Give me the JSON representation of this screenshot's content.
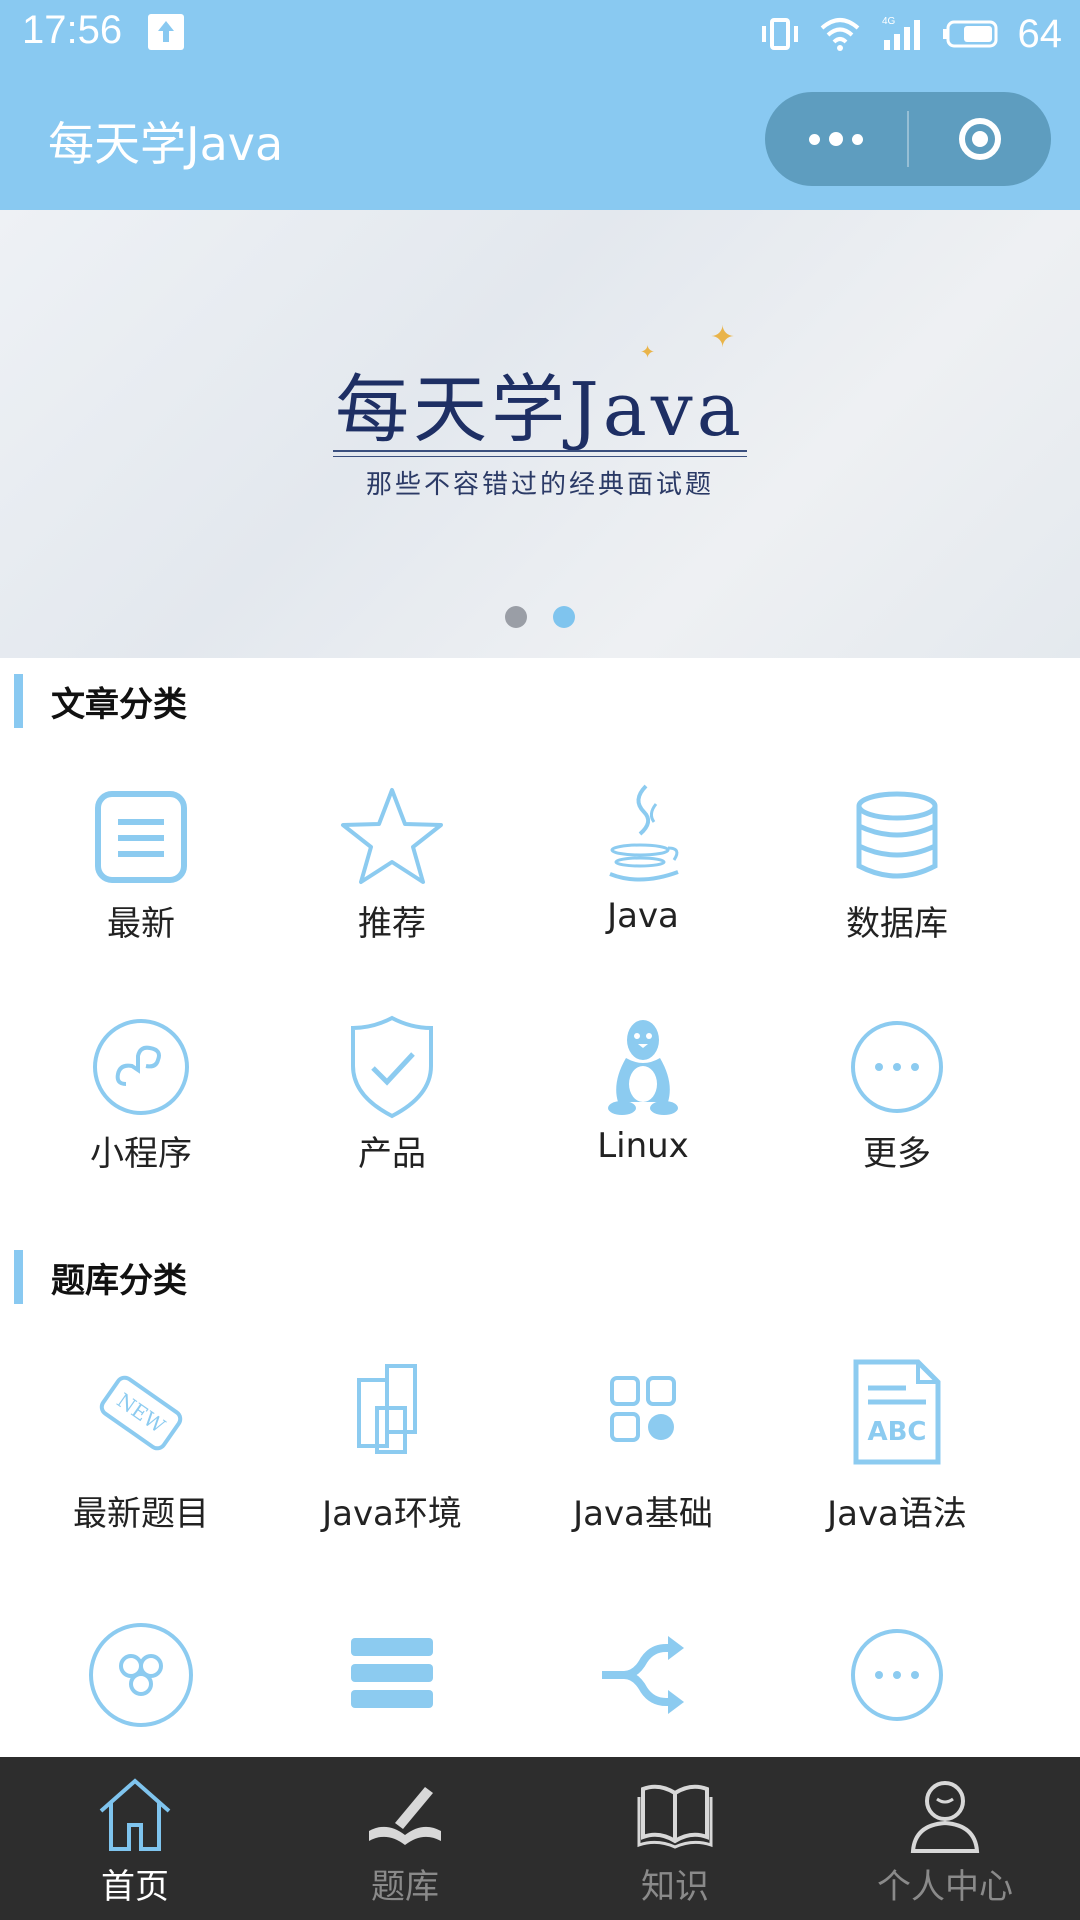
{
  "status_bar": {
    "time": "17:56",
    "battery": "64",
    "network": "4G"
  },
  "navbar": {
    "title": "每天学Java",
    "more_label": "more",
    "close_label": "close"
  },
  "banner": {
    "title": "每天学Java",
    "subtitle": "那些不容错过的经典面试题",
    "slide_count": 2,
    "active_slide": 2
  },
  "article_section": {
    "title": "文章分类",
    "items": [
      {
        "label": "最新",
        "icon": "list-doc-icon"
      },
      {
        "label": "推荐",
        "icon": "star-icon"
      },
      {
        "label": "Java",
        "icon": "java-cup-icon"
      },
      {
        "label": "数据库",
        "icon": "database-icon"
      },
      {
        "label": "小程序",
        "icon": "miniprogram-icon"
      },
      {
        "label": "产品",
        "icon": "shield-check-icon"
      },
      {
        "label": "Linux",
        "icon": "penguin-icon"
      },
      {
        "label": "更多",
        "icon": "more-circle-icon"
      }
    ]
  },
  "question_section": {
    "title": "题库分类",
    "items": [
      {
        "label": "最新题目",
        "icon": "new-tag-icon"
      },
      {
        "label": "Java环境",
        "icon": "panels-icon"
      },
      {
        "label": "Java基础",
        "icon": "grid-icon"
      },
      {
        "label": "Java语法",
        "icon": "abc-doc-icon"
      },
      {
        "label": "",
        "icon": "circles-icon"
      },
      {
        "label": "",
        "icon": "layers-icon"
      },
      {
        "label": "",
        "icon": "shuffle-icon"
      },
      {
        "label": "",
        "icon": "more-circle-icon"
      }
    ]
  },
  "tabbar": {
    "tabs": [
      {
        "label": "首页",
        "icon": "home-icon",
        "active": true
      },
      {
        "label": "题库",
        "icon": "book-pen-icon",
        "active": false
      },
      {
        "label": "知识",
        "icon": "open-book-icon",
        "active": false
      },
      {
        "label": "个人中心",
        "icon": "user-icon",
        "active": false
      }
    ]
  },
  "colors": {
    "accent": "#89c9f1",
    "icon": "#8ccbf0",
    "tabbar_bg": "#2d2d2d",
    "capsule": "#5e9dbf"
  }
}
